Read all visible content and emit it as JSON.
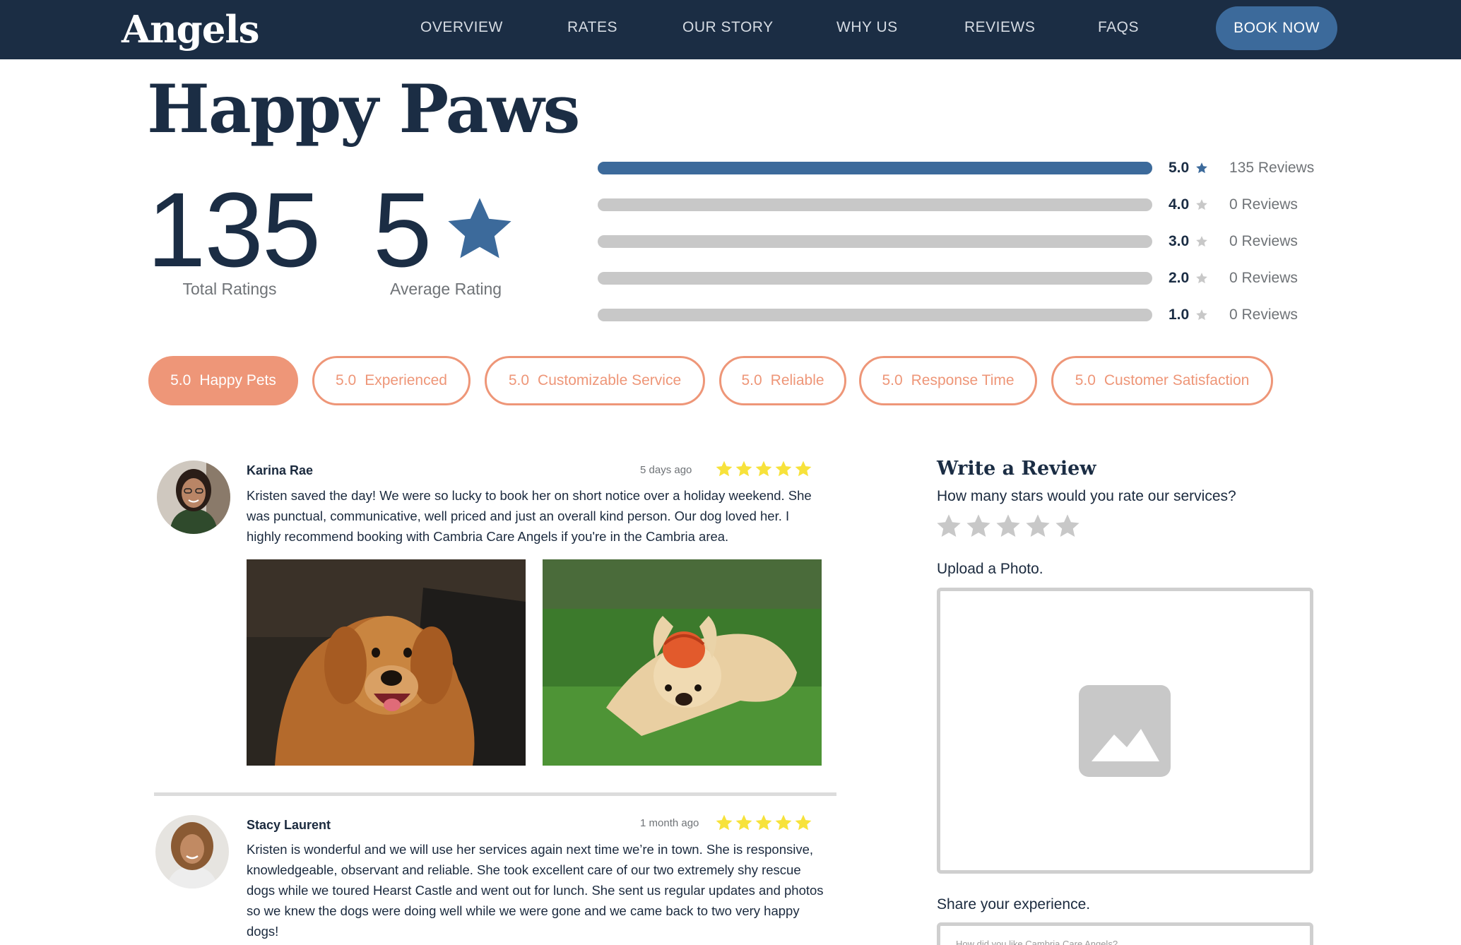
{
  "nav": {
    "logo": "Angels",
    "links": [
      "OVERVIEW",
      "RATES",
      "OUR STORY",
      "WHY US",
      "REVIEWS",
      "FAQS"
    ],
    "cta": "BOOK NOW"
  },
  "business": {
    "name": "Happy Paws"
  },
  "stats": {
    "total": "135",
    "total_label": "Total Ratings",
    "average": "5",
    "average_label": "Average Rating"
  },
  "breakdown": [
    {
      "level": "5.0",
      "count": "135 Reviews",
      "fill": 1.0
    },
    {
      "level": "4.0",
      "count": "0 Reviews",
      "fill": 0
    },
    {
      "level": "3.0",
      "count": "0 Reviews",
      "fill": 0
    },
    {
      "level": "2.0",
      "count": "0 Reviews",
      "fill": 0
    },
    {
      "level": "1.0",
      "count": "0 Reviews",
      "fill": 0
    }
  ],
  "categories": [
    {
      "score": "5.0",
      "label": "Happy Pets",
      "active": true
    },
    {
      "score": "5.0",
      "label": "Experienced",
      "active": false
    },
    {
      "score": "5.0",
      "label": "Customizable Service",
      "active": false
    },
    {
      "score": "5.0",
      "label": "Reliable",
      "active": false
    },
    {
      "score": "5.0",
      "label": "Response Time",
      "active": false
    },
    {
      "score": "5.0",
      "label": "Customer Satisfaction",
      "active": false
    }
  ],
  "reviews": [
    {
      "name": "Karina Rae",
      "date": "5 days ago",
      "rating": 5,
      "text": "Kristen saved the day! We were so lucky to book her on short notice over a holiday weekend. She was punctual, communicative, well priced and just an overall kind person. Our dog loved her. I highly recommend booking with Cambria Care Angels if you're in the Cambria area."
    },
    {
      "name": "Stacy Laurent",
      "date": "1 month ago",
      "rating": 5,
      "text": "Kristen is wonderful and we will use her services again next time we’re in town. She is responsive, knowledgeable, observant and reliable. She took excellent care of our two extremely shy rescue dogs while we toured Hearst Castle and went out for lunch. She sent us regular updates and photos so we knew the dogs were doing well while we were gone and we came back to two very happy dogs!"
    }
  ],
  "write_review": {
    "title": "Write a Review",
    "question": "How many stars would you rate our services?",
    "upload_label": "Upload a Photo.",
    "share_label": "Share your experience.",
    "share_placeholder": "How did you like Cambria Care Angels?"
  },
  "colors": {
    "navy": "#1b2d44",
    "accent_blue": "#3c6a9b",
    "coral": "#ee9678",
    "review_star": "#f7e23b",
    "muted_gray": "#c8c8c8"
  }
}
